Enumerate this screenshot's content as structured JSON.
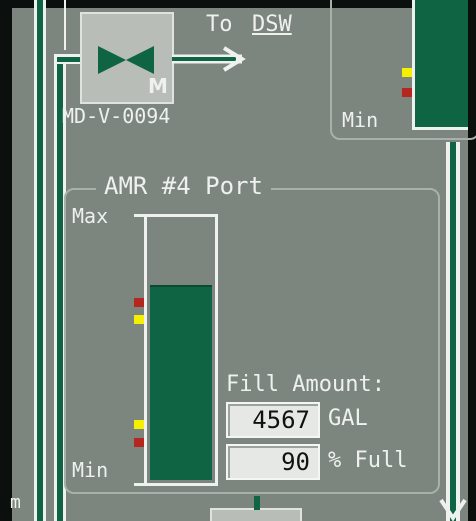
{
  "valve": {
    "tag": "MD-V-0094",
    "motor_label": "M",
    "flow_label": "To",
    "flow_target": "DSW"
  },
  "top_right_panel": {
    "min_label": "Min"
  },
  "tank_panel": {
    "title": "AMR #4 Port",
    "max_label": "Max",
    "min_label": "Min",
    "fill_fraction": 0.75,
    "fill_amount_label": "Fill Amount:",
    "gallons_value": "4567",
    "gallons_unit": "GAL",
    "percent_value": "90",
    "percent_unit": "% Full"
  },
  "left_edge_label": "m",
  "colors": {
    "background": "#7d857f",
    "pipe_green": "#0f6443",
    "marker_yellow": "#f4f000",
    "marker_red": "#b5261e"
  }
}
